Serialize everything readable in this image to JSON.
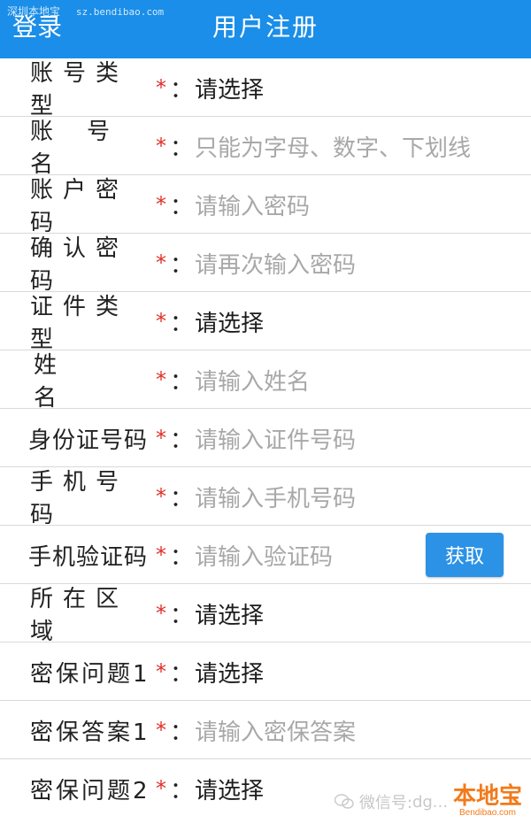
{
  "watermark_top": {
    "text": "深圳本地宝",
    "site": "sz.bendibao.com"
  },
  "header": {
    "login_label": "登录",
    "title": "用户注册",
    "color": "#1a8ee8"
  },
  "colors": {
    "required_star": "#e1302a",
    "placeholder": "#a8a8a8",
    "button": "#2b92e6"
  },
  "form": {
    "rows": [
      {
        "label": "账号类型",
        "value": "请选择",
        "is_placeholder": false
      },
      {
        "label": "账号名",
        "value": "只能为字母、数字、下划线",
        "is_placeholder": true
      },
      {
        "label": "账户密码",
        "value": "请输入密码",
        "is_placeholder": true
      },
      {
        "label": "确认密码",
        "value": "请再次输入密码",
        "is_placeholder": true
      },
      {
        "label": "证件类型",
        "value": "请选择",
        "is_placeholder": false
      },
      {
        "label": "姓名",
        "value": "请输入姓名",
        "is_placeholder": true
      },
      {
        "label": "身份证号码",
        "value": "请输入证件号码",
        "is_placeholder": true
      },
      {
        "label": "手机号码",
        "value": "请输入手机号码",
        "is_placeholder": true
      },
      {
        "label": "手机验证码",
        "value": "请输入验证码",
        "is_placeholder": true,
        "button": "获取"
      },
      {
        "label": "所在区域",
        "value": "请选择",
        "is_placeholder": false
      },
      {
        "label": "密保问题1",
        "value": "请选择",
        "is_placeholder": false
      },
      {
        "label": "密保答案1",
        "value": "请输入密保答案",
        "is_placeholder": true
      },
      {
        "label": "密保问题2",
        "value": "请选择",
        "is_placeholder": false
      }
    ],
    "required_mark": "*",
    "colon": "："
  },
  "bottom_watermark": {
    "wechat_text": "微信号: ",
    "account": "dg...",
    "brand": "本地宝",
    "brand_sub": "Bendibao.com"
  }
}
